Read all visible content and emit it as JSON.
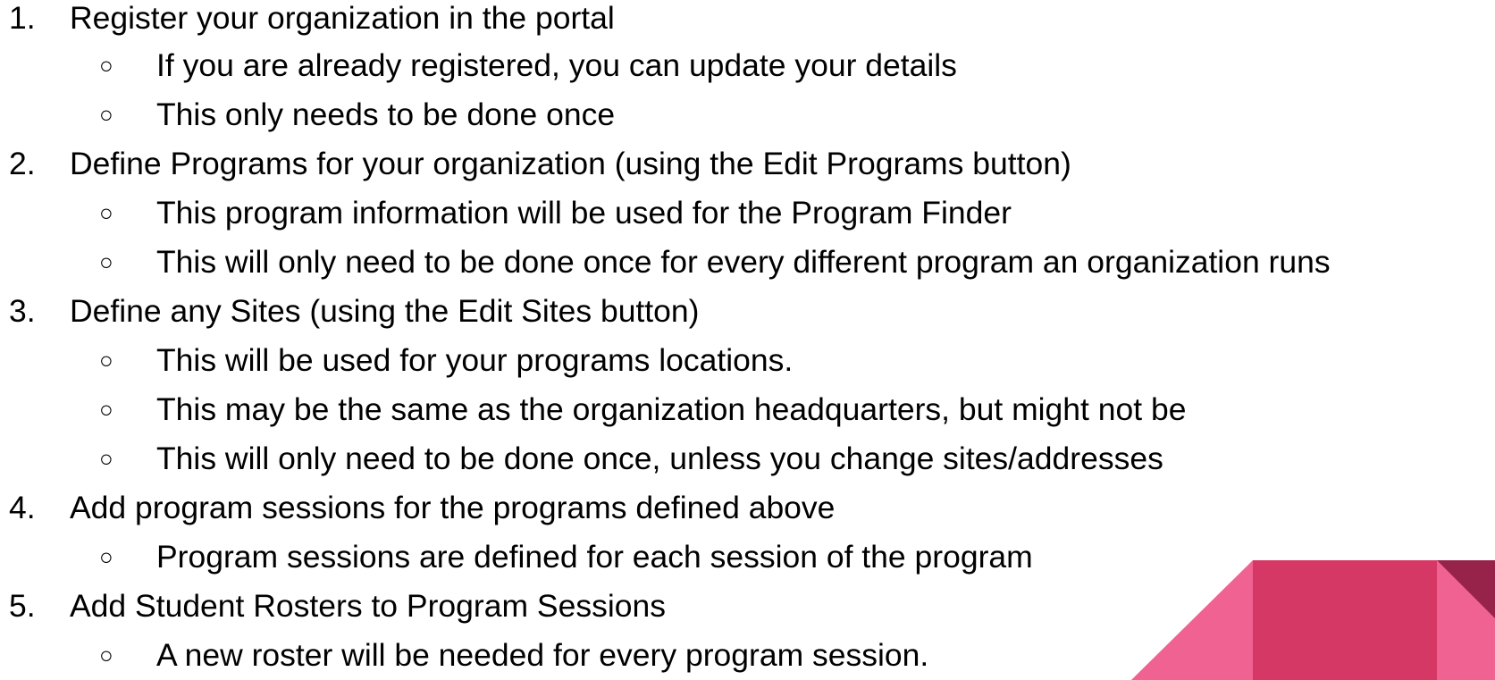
{
  "steps": [
    {
      "number": "1.",
      "text": "Register your organization in the portal",
      "sub": [
        "If you are already registered, you can update your details",
        "This only needs to be done once"
      ]
    },
    {
      "number": "2.",
      "text": "Define Programs for your organization (using the Edit Programs button)",
      "sub": [
        "This program information will be used for the Program Finder",
        "This will only need to be done once for every different program an organization runs"
      ]
    },
    {
      "number": "3.",
      "text": "Define any Sites (using the Edit Sites button)",
      "sub": [
        "This will be used for your programs locations.",
        "This may be the same as the organization headquarters, but might not be",
        "This will only need to be done once, unless you change sites/addresses"
      ]
    },
    {
      "number": "4.",
      "text": "Add program sessions for the programs defined above",
      "sub": [
        "Program sessions are defined for each session of the program"
      ]
    },
    {
      "number": "5.",
      "text": "Add Student Rosters to Program Sessions",
      "sub": [
        "A new roster will be needed for every program session."
      ]
    }
  ],
  "bullet_glyph": "○",
  "colors": {
    "text": "#000000",
    "deco_light": "#f06292",
    "deco_mid": "#d63865",
    "deco_dark": "#97234b"
  }
}
